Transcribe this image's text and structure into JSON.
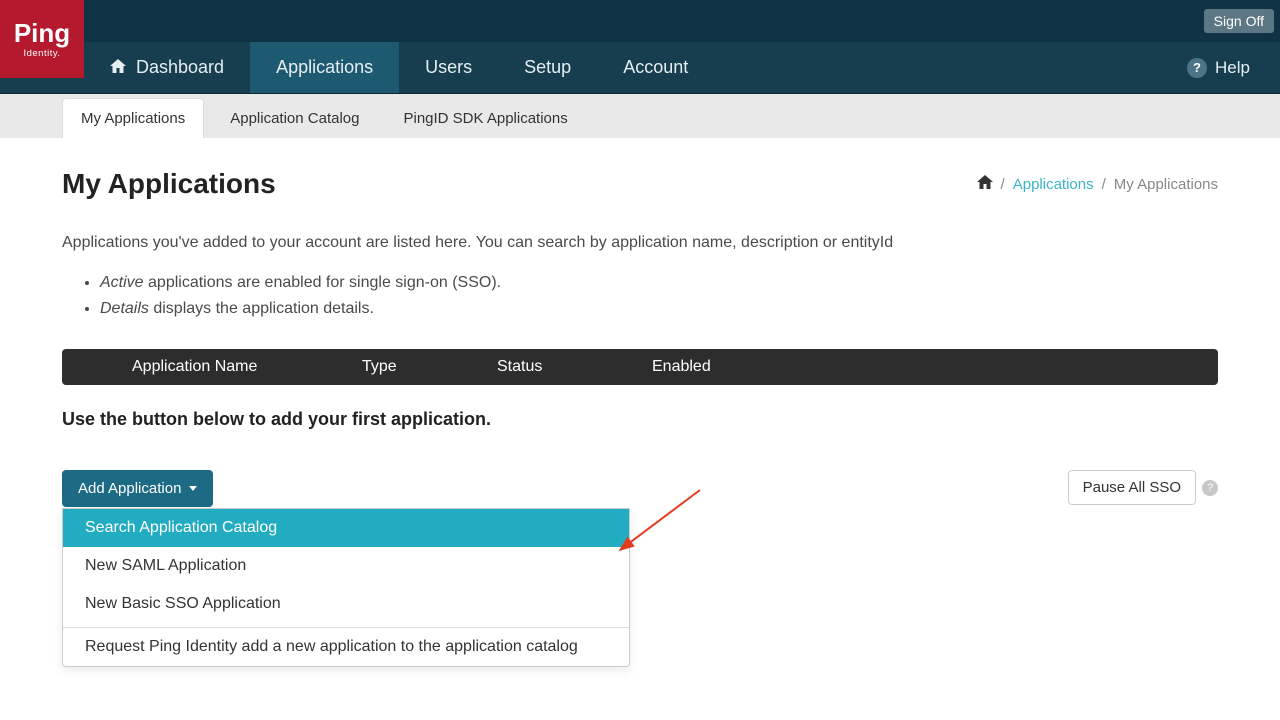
{
  "header": {
    "sign_off": "Sign Off",
    "logo_main": "Ping",
    "logo_sub": "Identity.",
    "help": "Help"
  },
  "nav": {
    "items": [
      {
        "label": "Dashboard",
        "has_home_icon": true
      },
      {
        "label": "Applications",
        "active": true
      },
      {
        "label": "Users"
      },
      {
        "label": "Setup"
      },
      {
        "label": "Account"
      }
    ]
  },
  "subnav": {
    "tabs": [
      {
        "label": "My Applications",
        "active": true
      },
      {
        "label": "Application Catalog"
      },
      {
        "label": "PingID SDK Applications"
      }
    ]
  },
  "breadcrumb": {
    "link": "Applications",
    "current": "My Applications"
  },
  "page": {
    "title": "My Applications",
    "intro": "Applications you've added to your account are listed here. You can search by application name, description or entityId",
    "bullet1_em": "Active",
    "bullet1_rest": " applications are enabled for single sign-on (SSO).",
    "bullet2_em": "Details",
    "bullet2_rest": " displays the application details.",
    "empty_msg": "Use the button below to add your first application."
  },
  "table": {
    "headers": {
      "name": "Application Name",
      "type": "Type",
      "status": "Status",
      "enabled": "Enabled"
    }
  },
  "buttons": {
    "add_application": "Add Application",
    "pause_all_sso": "Pause All SSO"
  },
  "dropdown": {
    "items": [
      {
        "label": "Search Application Catalog",
        "highlight": true
      },
      {
        "label": "New SAML Application"
      },
      {
        "label": "New Basic SSO Application"
      }
    ],
    "footer": "Request Ping Identity add a new application to the application catalog"
  }
}
